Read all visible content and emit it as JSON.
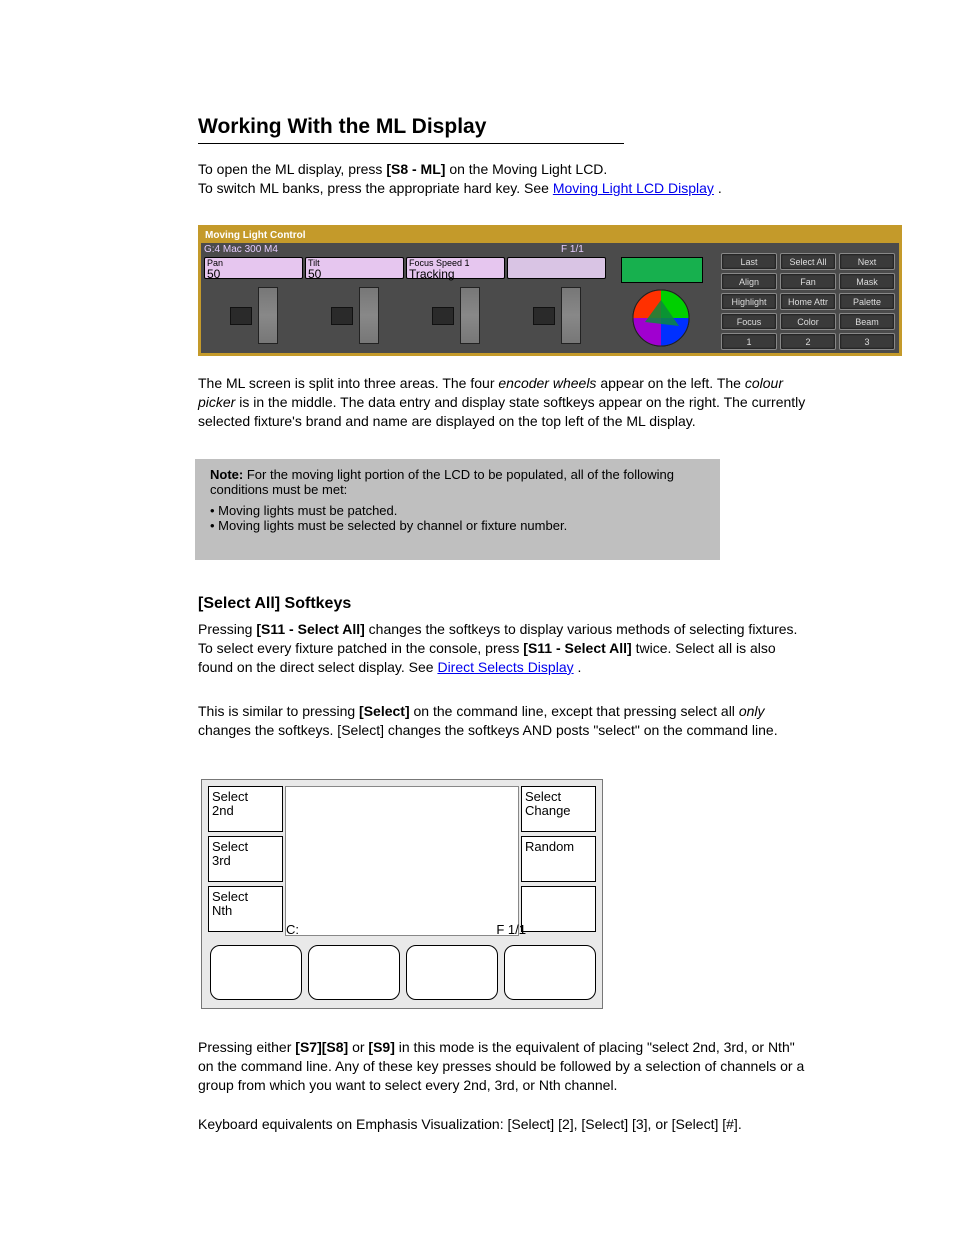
{
  "section": {
    "title": "Working With the ML Display"
  },
  "intro": {
    "line1_a": "To open the ML display, press ",
    "line1_b_strong": "[S8 - ML]",
    "line1_c": " on the Moving Light LCD.",
    "line2_a": "To switch ML banks, press the appropriate hard key. See ",
    "link2": "Moving Light LCD Display",
    "line2_b": "."
  },
  "mlc": {
    "title": "Moving Light Control",
    "status_left": "G:4   Mac 300 M4",
    "status_right": "F 1/1",
    "attrs": [
      {
        "label": "Pan",
        "value": "50"
      },
      {
        "label": "Tilt",
        "value": "50"
      },
      {
        "label": "Focus Speed  1",
        "value": "Tracking"
      },
      {
        "label": "",
        "value": ""
      }
    ],
    "swatch_color": "#17b04e",
    "buttons": [
      [
        "Last",
        "Select All",
        "Next"
      ],
      [
        "Align",
        "Fan",
        "Mask"
      ],
      [
        "Highlight",
        "Home Attr",
        "Palette"
      ],
      [
        "Focus",
        "Color",
        "Beam"
      ],
      [
        "1",
        "2",
        "3"
      ]
    ]
  },
  "after_fig1": {
    "line1_a": "The ML screen is split into three areas. The four ",
    "line1_em": "encoder wheels",
    "line1_b": " appear on the left. The ",
    "line2_em": "colour picker",
    "line2_b": " is in the middle. The data entry and display state softkeys appear on the right. The currently selected fixture's brand and name are displayed on the top left of the ML display."
  },
  "note_box": {
    "strong": "Note:",
    "text1": " For the moving light portion of the LCD to be populated, all of the following conditions must be met:",
    "bullets": [
      "• Moving lights must be patched.",
      "• Moving lights must be selected by channel or fixture number."
    ]
  },
  "softkeys": {
    "heading": "[Select All] Softkeys",
    "para1_a": "Pressing ",
    "para1_b_strong": "[S11 - Select All]",
    "para1_c": " changes the softkeys to display various methods of selecting fixtures. To select every fixture patched in the console, press ",
    "para1_d_strong": "[S11 - Select All]",
    "para1_e": " twice. Select all is also found on the direct select display. See ",
    "para1_link": "Direct Selects Display",
    "para1_f": ".",
    "para2_a": "This is similar to pressing ",
    "para2_strong": "[Select]",
    "para2_b": " on the command line, except that pressing select all ",
    "para2_em": "only ",
    "para2_c": "changes the softkeys. [Select] changes the softkeys AND posts \"select\" on the command line.",
    "panel": {
      "left_buttons": [
        "Select\n2nd",
        "Select\n3rd",
        "Select\nNth"
      ],
      "right_buttons": [
        "Select\nChange",
        "Random",
        ""
      ],
      "mid_left": "C:",
      "mid_right": "F  1/1"
    }
  },
  "tail": {
    "p5_a": "Pressing either ",
    "p5_strong_a": "[S7][S8]",
    "p5_b": " or ",
    "p5_strong_b": "[S9]",
    "p5_c": " in this mode is the equivalent of placing \"select 2nd, 3rd, or Nth\" on the command line. Any of these key presses should be followed by a selection of channels or a group from which you want to select every 2nd, 3rd, or Nth channel.",
    "para6": "Keyboard equivalents on Emphasis Visualization: [Select] [2], [Select] [3], or [Select] [#]."
  }
}
